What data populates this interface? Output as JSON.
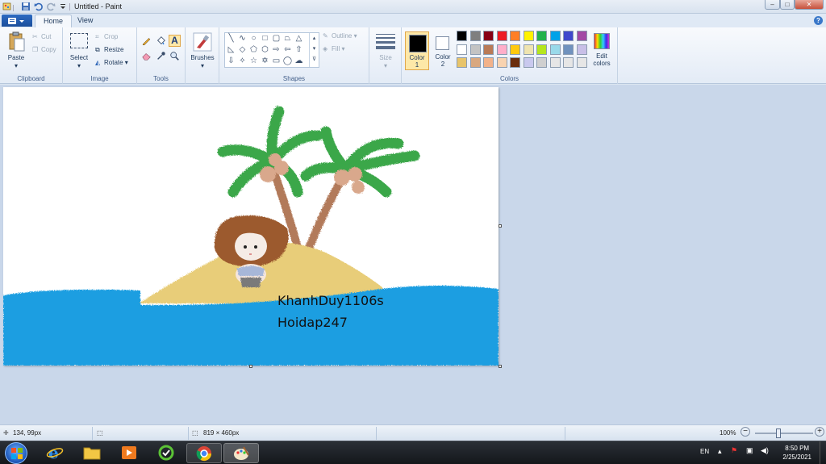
{
  "titlebar": {
    "title": "Untitled - Paint",
    "minimize": "–",
    "maximize": "□",
    "close": "✕"
  },
  "tabs": [
    {
      "label": "Home"
    },
    {
      "label": "View"
    }
  ],
  "ribbon": {
    "clipboard": {
      "label": "Clipboard",
      "paste": "Paste",
      "cut": "Cut",
      "copy": "Copy"
    },
    "image": {
      "label": "Image",
      "select": "Select",
      "crop": "Crop",
      "resize": "Resize",
      "rotate": "Rotate"
    },
    "tools": {
      "label": "Tools"
    },
    "brushes": {
      "label": "Brushes"
    },
    "shapes": {
      "label": "Shapes",
      "outline": "Outline",
      "fill": "Fill"
    },
    "size": {
      "label": "Size"
    },
    "colors": {
      "label": "Colors",
      "color1": "Color\n1",
      "color1_value": "#000000",
      "color2": "Color\n2",
      "color2_value": "#ffffff",
      "edit": "Edit\ncolors",
      "palette_row1": [
        "#000000",
        "#7f7f7f",
        "#880015",
        "#ed1c24",
        "#ff7f27",
        "#fff200",
        "#22b14c",
        "#00a2e8",
        "#3f48cc",
        "#a349a4"
      ],
      "palette_row2": [
        "#ffffff",
        "#c3c3c3",
        "#b97a57",
        "#ffaec9",
        "#ffc90e",
        "#efe4b0",
        "#b5e61d",
        "#99d9ea",
        "#7092be",
        "#c8bfe7"
      ],
      "palette_row3": [
        "#e8c46a",
        "#d9a87f",
        "#f2b28a",
        "#f8d3b0",
        "#6b2e0e",
        "#c9c9ee",
        "#cfcfcf",
        "#e6e6e6",
        "#e6e6e6",
        "#e6e6e6"
      ]
    }
  },
  "canvas": {
    "text_line1": "KhanhDuy1106s",
    "text_line2": "Hoidap247"
  },
  "status": {
    "cursor": "134, 99px",
    "size": "819 × 460px",
    "zoom": "100%",
    "zoom_level": 1.0
  },
  "taskbar": {
    "lang": "EN",
    "time": "8:50 PM",
    "date": "2/25/2021"
  }
}
